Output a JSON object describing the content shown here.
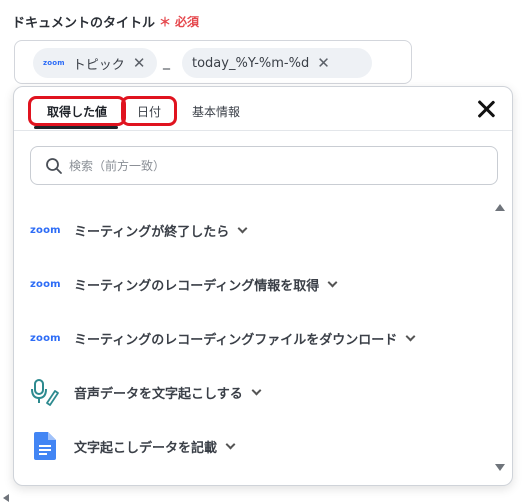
{
  "field": {
    "label": "ドキュメントのタイトル",
    "required_mark": "＊",
    "required_text": "必須"
  },
  "chips": {
    "zoom_logo": "zoom",
    "topic": "トピック",
    "separator": "_",
    "date_format": "today_%Y-%m-%d"
  },
  "tabs": [
    {
      "label": "取得した値"
    },
    {
      "label": "日付"
    },
    {
      "label": "基本情報"
    }
  ],
  "search": {
    "placeholder": "検索（前方一致）"
  },
  "items": [
    {
      "icon": "zoom-logo",
      "icon_text": "zoom",
      "label": "ミーティングが終了したら"
    },
    {
      "icon": "zoom-logo",
      "icon_text": "zoom",
      "label": "ミーティングのレコーディング情報を取得"
    },
    {
      "icon": "zoom-logo",
      "icon_text": "zoom",
      "label": "ミーティングのレコーディングファイルをダウンロード"
    },
    {
      "icon": "microphone-pen-icon",
      "label": "音声データを文字起こしする"
    },
    {
      "icon": "google-docs-icon",
      "label": "文字起こしデータを記載"
    }
  ],
  "colors": {
    "accent_red": "#e0131f",
    "zoom_blue": "#2d6cf6",
    "teal": "#2d8a8f",
    "docs_blue": "#4285f4"
  }
}
